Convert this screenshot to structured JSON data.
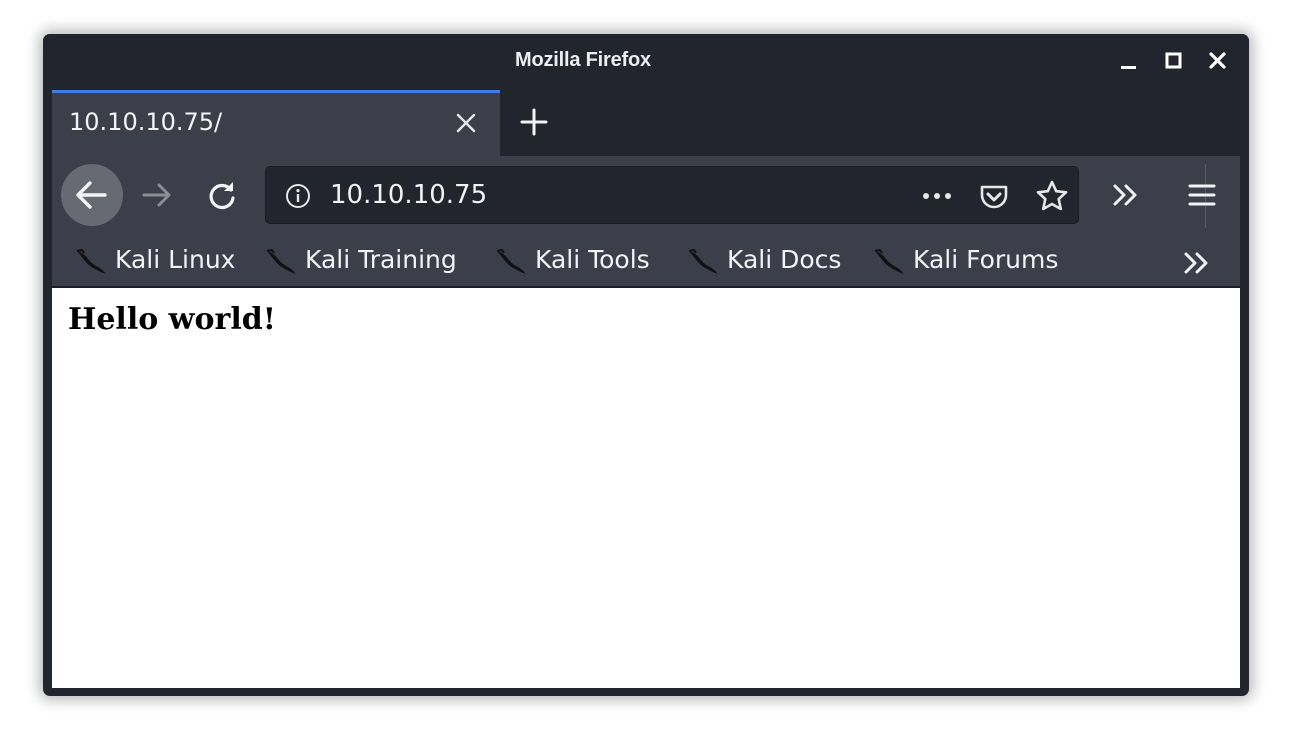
{
  "window": {
    "title": "Mozilla Firefox"
  },
  "tabs": [
    {
      "label": "10.10.10.75/",
      "active": true
    }
  ],
  "navbar": {
    "url": "10.10.10.75"
  },
  "bookmarks": [
    {
      "label": "Kali Linux"
    },
    {
      "label": "Kali Training"
    },
    {
      "label": "Kali Tools"
    },
    {
      "label": "Kali Docs"
    },
    {
      "label": "Kali Forums"
    }
  ],
  "page": {
    "heading": "Hello world!"
  },
  "colors": {
    "chrome_dark": "#23252e",
    "chrome_toolbar": "#3c3f49",
    "tab_accent": "#3a7ee6",
    "content_bg": "#ffffff"
  },
  "icons": {
    "minimize": "minimize-icon",
    "maximize": "maximize-icon",
    "close": "close-icon",
    "back": "arrow-left-icon",
    "forward": "arrow-right-icon",
    "reload": "reload-icon",
    "site_info": "info-icon",
    "page_actions": "ellipsis-icon",
    "pocket": "pocket-icon",
    "bookmark_star": "star-icon",
    "overflow": "double-chevron-icon",
    "menu": "hamburger-icon",
    "bookmark_favicon": "kali-dragon-icon"
  }
}
